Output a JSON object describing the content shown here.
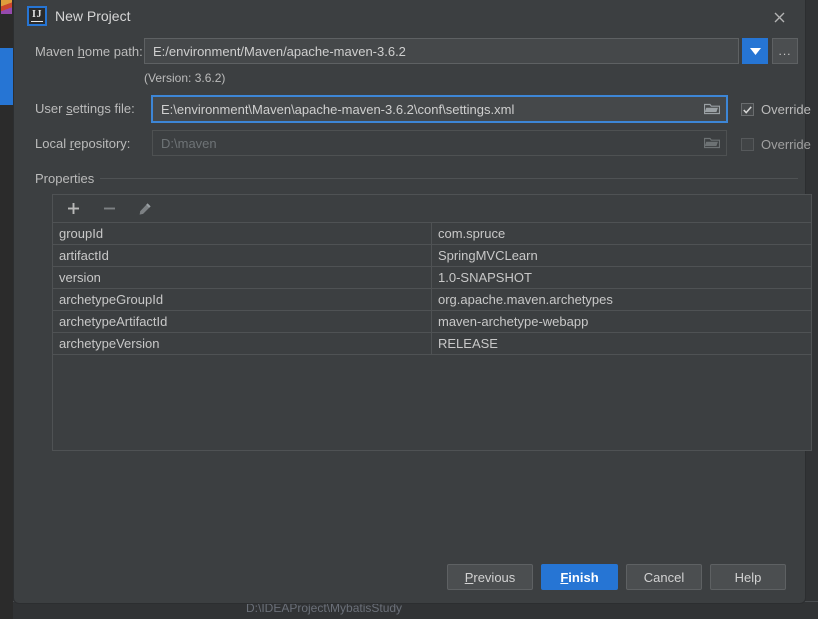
{
  "backdrop": {
    "project_path": "D:\\IDEAProject\\MybatisStudy"
  },
  "dialog": {
    "title": "New Project",
    "app_icon_glyph": "IJ",
    "close_icon": "close-icon"
  },
  "form": {
    "maven_home": {
      "label_pre": "Maven ",
      "label_mnemonic": "h",
      "label_post": "ome path:",
      "value": "E:/environment/Maven/apache-maven-3.6.2",
      "dropdown_icon": "chevron-down-icon",
      "browse_label": "...",
      "version_note": "(Version: 3.6.2)"
    },
    "user_settings": {
      "label_pre": "User ",
      "label_mnemonic": "s",
      "label_post": "ettings file:",
      "value": "E:\\environment\\Maven\\apache-maven-3.6.2\\conf\\settings.xml",
      "folder_icon": "folder-icon",
      "override_label": "Override",
      "override_checked": true
    },
    "local_repository": {
      "label_pre": "Local ",
      "label_mnemonic": "r",
      "label_post": "epository:",
      "value": "D:\\maven",
      "folder_icon": "folder-icon",
      "override_label": "Override",
      "override_checked": false
    }
  },
  "properties": {
    "group_title": "Properties",
    "toolbar": {
      "add_icon": "plus-icon",
      "remove_icon": "minus-icon",
      "edit_icon": "pencil-icon"
    },
    "rows": [
      {
        "key": "groupId",
        "value": "com.spruce"
      },
      {
        "key": "artifactId",
        "value": "SpringMVCLearn"
      },
      {
        "key": "version",
        "value": "1.0-SNAPSHOT"
      },
      {
        "key": "archetypeGroupId",
        "value": "org.apache.maven.archetypes"
      },
      {
        "key": "archetypeArtifactId",
        "value": "maven-archetype-webapp"
      },
      {
        "key": "archetypeVersion",
        "value": "RELEASE"
      }
    ]
  },
  "footer": {
    "previous": {
      "pre": "",
      "mnemonic": "P",
      "post": "revious"
    },
    "finish": {
      "pre": "",
      "mnemonic": "F",
      "post": "inish"
    },
    "cancel": {
      "label": "Cancel"
    },
    "help": {
      "label": "Help"
    }
  },
  "colors": {
    "accent": "#2675d4",
    "focus_border": "#3d86d6",
    "dialog_bg": "#3c3f41",
    "field_bg": "#45484a"
  }
}
